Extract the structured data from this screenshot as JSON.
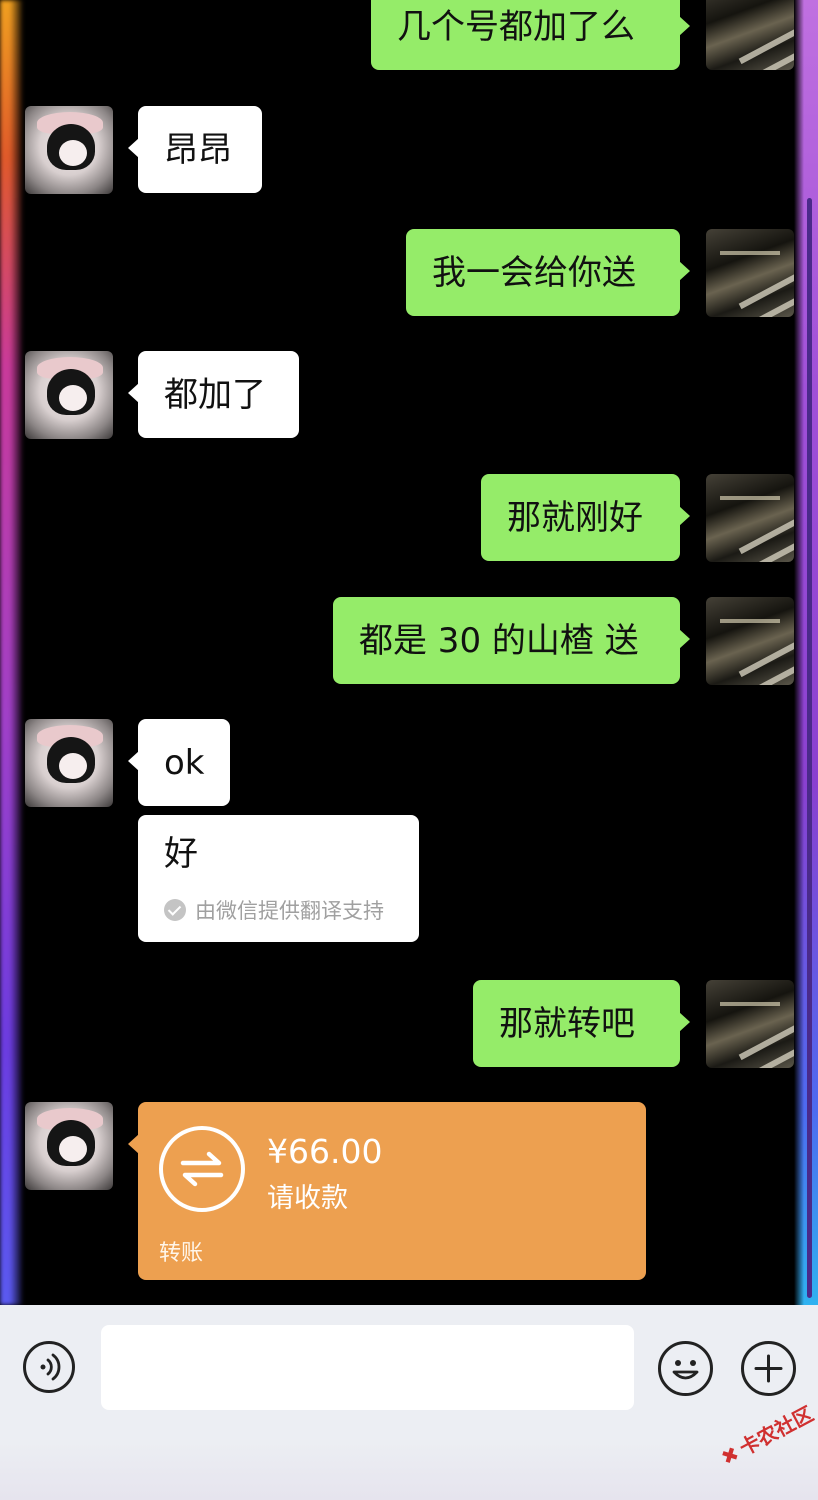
{
  "messages": [
    {
      "side": "me",
      "text": "几个号都加了么"
    },
    {
      "side": "other",
      "text": "昂昂"
    },
    {
      "side": "me",
      "text": "我一会给你送"
    },
    {
      "side": "other",
      "text": "都加了"
    },
    {
      "side": "me",
      "text": "那就刚好"
    },
    {
      "side": "me",
      "text": "都是 30 的山楂 送"
    },
    {
      "side": "other",
      "text": "ok"
    },
    {
      "side": "other",
      "text": "好",
      "translation_note": "由微信提供翻译支持"
    },
    {
      "side": "me",
      "text": "那就转吧"
    }
  ],
  "transfer": {
    "amount": "¥66.00",
    "status": "请收款",
    "label": "转账"
  },
  "input_bar": {
    "message_value": "",
    "voice_icon": "voice-icon",
    "emoji_icon": "emoji-icon",
    "plus_icon": "plus-icon"
  },
  "watermark": {
    "text": "卡农社区"
  },
  "colors": {
    "my_bubble": "#95ec69",
    "other_bubble": "#ffffff",
    "transfer_card": "#eda050",
    "chat_background": "#000000",
    "input_bar": "#eceef3"
  }
}
